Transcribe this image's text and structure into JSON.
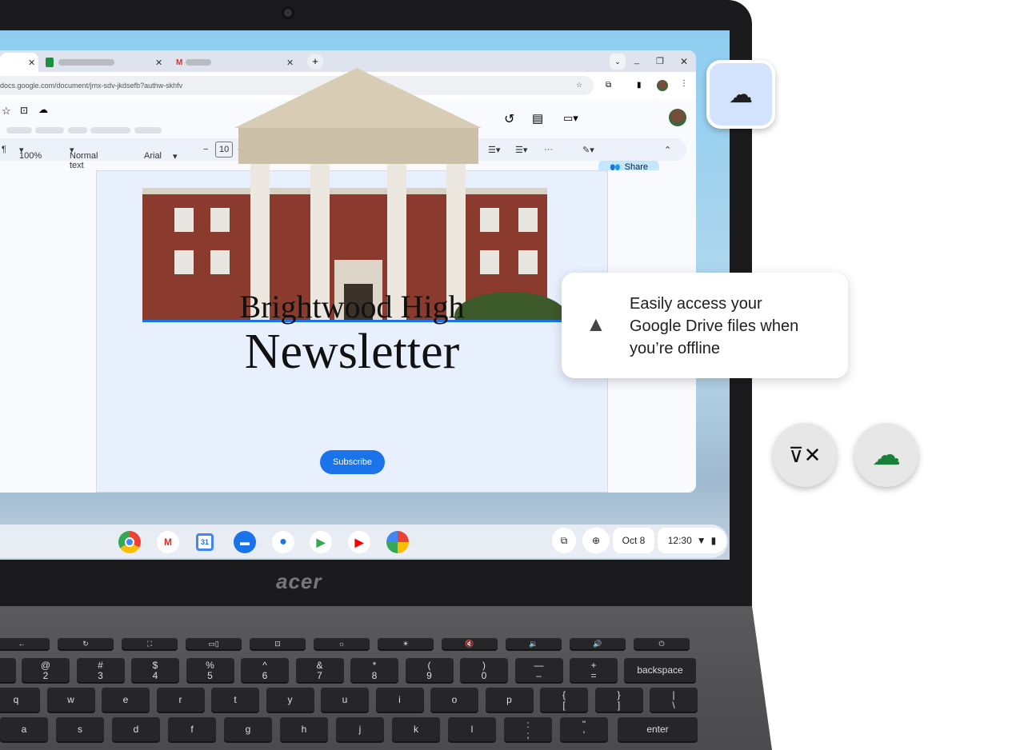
{
  "browser": {
    "tabs": [
      {
        "label": "",
        "active": true
      },
      {
        "label": "",
        "icon": "sheets-icon"
      },
      {
        "label": "",
        "icon": "gmail-icon"
      }
    ],
    "url": "docs.google.com/document/jmx-sdv-jkdsefb?authw-skhfv",
    "new_tab": "+"
  },
  "docs": {
    "zoom": "100%",
    "style": "Normal text",
    "font": "Arial",
    "font_size": "10",
    "share_label": "Share"
  },
  "document": {
    "title_line1": "Brightwood High",
    "title_line2": "Newsletter",
    "subscribe_label": "Subscribe"
  },
  "shelf": {
    "apps": [
      "chrome",
      "gmail",
      "calendar",
      "files",
      "messages",
      "play-store",
      "youtube",
      "photos"
    ],
    "calendar_day": "31",
    "date": "Oct 8",
    "time": "12:30"
  },
  "callout": {
    "text": "Easily access your Google Drive files when you’re offline"
  },
  "brand": "acer",
  "keyboard": {
    "number_row": [
      [
        "@",
        "2"
      ],
      [
        "#",
        "3"
      ],
      [
        "$",
        "4"
      ],
      [
        "%",
        "5"
      ],
      [
        "^",
        "6"
      ],
      [
        "&",
        "7"
      ],
      [
        "*",
        "8"
      ],
      [
        "(",
        "9"
      ],
      [
        ")",
        "0"
      ],
      [
        "—",
        "–"
      ],
      [
        "+",
        "="
      ]
    ],
    "backspace": "backspace",
    "q_row": [
      "q",
      "w",
      "e",
      "r",
      "t",
      "y",
      "u",
      "i",
      "o",
      "p",
      [
        "{",
        "["
      ],
      [
        "}",
        "]"
      ],
      [
        "|",
        "\\"
      ]
    ],
    "a_row": [
      "a",
      "s",
      "d",
      "f",
      "g",
      "h",
      "j",
      "k",
      "l",
      [
        ":",
        ";"
      ],
      [
        "\"",
        "'"
      ]
    ],
    "enter": "enter"
  },
  "colors": {
    "accent": "#1a73e8",
    "share_bg": "#c2e7ff",
    "sync_green": "#188038",
    "bezel": "#1b1b1d"
  }
}
